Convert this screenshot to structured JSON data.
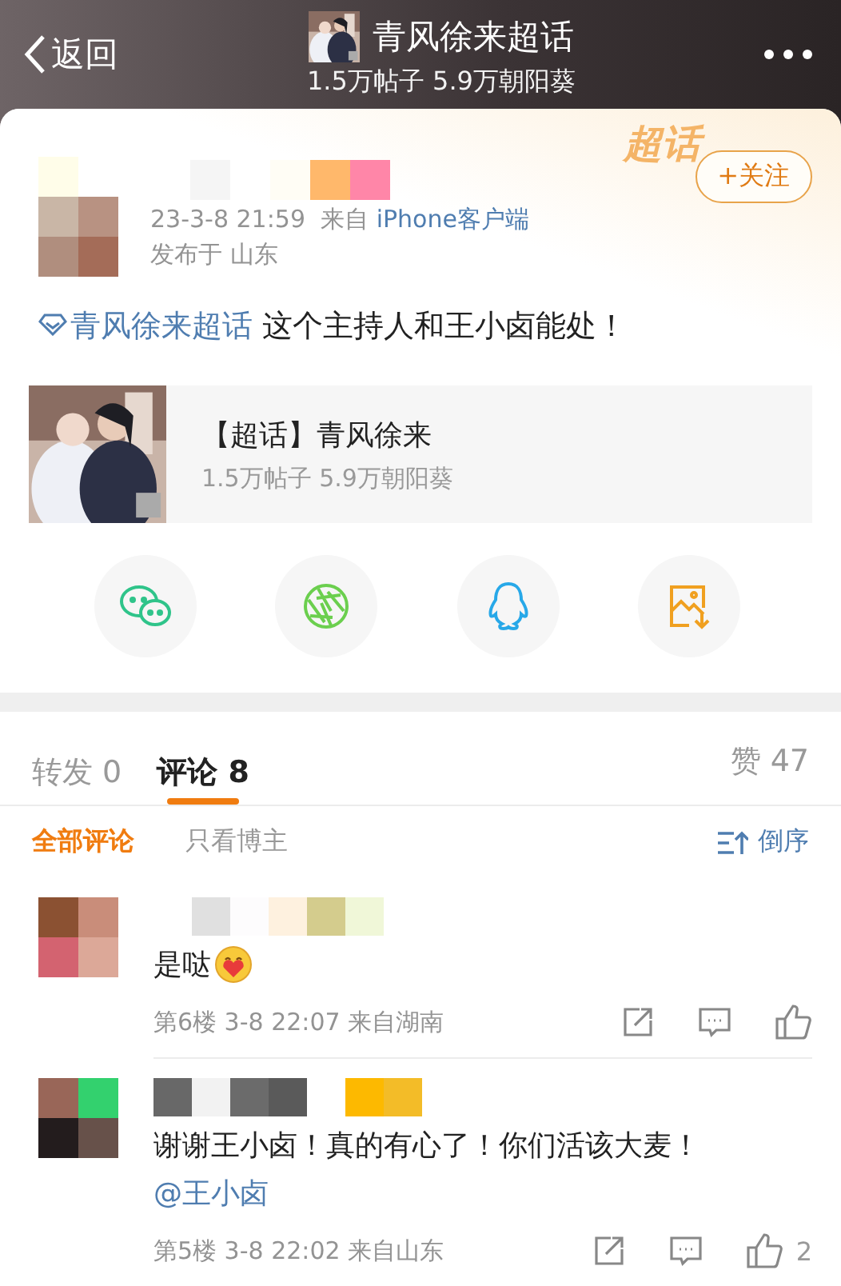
{
  "header": {
    "back_label": "返回",
    "title": "青风徐来超话",
    "stats": "1.5万帖子 5.9万朝阳葵"
  },
  "post": {
    "badge": "超话",
    "follow_label": "+关注",
    "time": "23-3-8 21:59",
    "source_prefix": "来自",
    "source": "iPhone客户端",
    "location": "发布于 山东",
    "topic_link": "青风徐来超话",
    "text": " 这个主持人和王小卤能处！",
    "card": {
      "title": "【超话】青风徐来",
      "stats": "1.5万帖子 5.9万朝阳葵"
    }
  },
  "tabs": [
    {
      "label": "转发 0",
      "selected": false
    },
    {
      "label": "评论 8",
      "selected": true
    }
  ],
  "likes": "赞 47",
  "filters": [
    {
      "label": "全部评论",
      "selected": true
    },
    {
      "label": "只看博主",
      "selected": false
    }
  ],
  "sort_label": "倒序",
  "comments": [
    {
      "text": "是哒",
      "sticker": true,
      "meta": "第6楼 3-8 22:07 来自湖南"
    },
    {
      "text": "谢谢王小卤！真的有心了！你们活该大麦！",
      "mention": "@王小卤",
      "sticker": false,
      "meta": "第5楼 3-8 22:02 来自山东",
      "like_count": "2"
    }
  ]
}
